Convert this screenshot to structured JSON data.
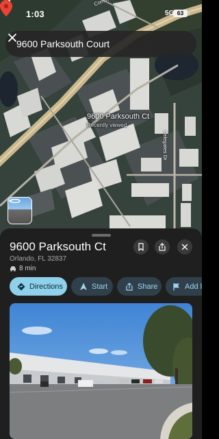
{
  "status_bar": {
    "time": "1:03",
    "network": "5G",
    "battery": "63"
  },
  "search": {
    "query": "9600 Parksouth Court"
  },
  "map": {
    "place_label": "9600 Parksouth Ct",
    "place_sublabel": "Recently viewed",
    "road_labels": [
      "Delegates Dr",
      "Comm"
    ]
  },
  "sheet": {
    "title": "9600 Parksouth Ct",
    "address": "Orlando, FL 32837",
    "drive_time": "8 min",
    "actions": {
      "directions": "Directions",
      "start": "Start",
      "share": "Share",
      "add_label": "Add la"
    }
  },
  "colors": {
    "sheet_bg": "#1f1f1f",
    "directions_chip": "#8fd1ea",
    "chip_bg": "#30404a",
    "chip_text": "#9fd6ee",
    "pin": "#ea4335"
  }
}
